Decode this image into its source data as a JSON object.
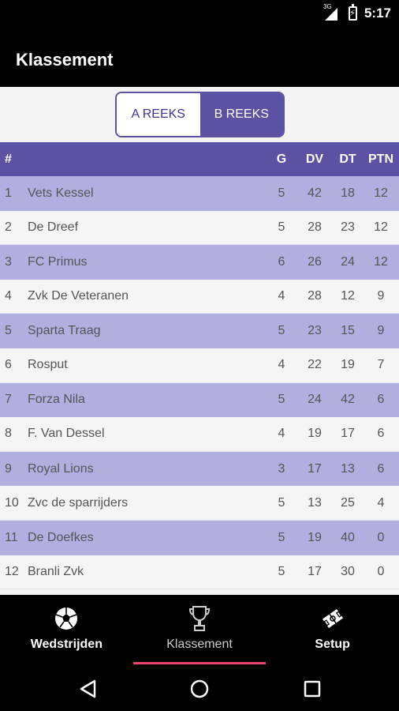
{
  "status_bar": {
    "network": "3G",
    "time": "5:17"
  },
  "app_bar": {
    "title": "Klassement"
  },
  "segment": {
    "options": [
      "A REEKS",
      "B REEKS"
    ],
    "selected": "B REEKS"
  },
  "table": {
    "headers": {
      "rank": "#",
      "team": "",
      "g": "G",
      "dv": "DV",
      "dt": "DT",
      "ptn": "PTN"
    },
    "rows": [
      {
        "rank": "1",
        "team": "Vets Kessel",
        "g": "5",
        "dv": "42",
        "dt": "18",
        "ptn": "12"
      },
      {
        "rank": "2",
        "team": "De Dreef",
        "g": "5",
        "dv": "28",
        "dt": "23",
        "ptn": "12"
      },
      {
        "rank": "3",
        "team": "FC Primus",
        "g": "6",
        "dv": "26",
        "dt": "24",
        "ptn": "12"
      },
      {
        "rank": "4",
        "team": "Zvk De Veteranen",
        "g": "4",
        "dv": "28",
        "dt": "12",
        "ptn": "9"
      },
      {
        "rank": "5",
        "team": "Sparta Traag",
        "g": "5",
        "dv": "23",
        "dt": "15",
        "ptn": "9"
      },
      {
        "rank": "6",
        "team": "Rosput",
        "g": "4",
        "dv": "22",
        "dt": "19",
        "ptn": "7"
      },
      {
        "rank": "7",
        "team": "Forza Nila",
        "g": "5",
        "dv": "24",
        "dt": "42",
        "ptn": "6"
      },
      {
        "rank": "8",
        "team": "F. Van Dessel",
        "g": "4",
        "dv": "19",
        "dt": "17",
        "ptn": "6"
      },
      {
        "rank": "9",
        "team": "Royal Lions",
        "g": "3",
        "dv": "17",
        "dt": "13",
        "ptn": "6"
      },
      {
        "rank": "10",
        "team": "Zvc de sparrijders",
        "g": "5",
        "dv": "13",
        "dt": "25",
        "ptn": "4"
      },
      {
        "rank": "11",
        "team": "De Doefkes",
        "g": "5",
        "dv": "19",
        "dt": "40",
        "ptn": "0"
      },
      {
        "rank": "12",
        "team": "Branli Zvk",
        "g": "5",
        "dv": "17",
        "dt": "30",
        "ptn": "0"
      }
    ]
  },
  "bottom_nav": {
    "items": [
      {
        "label": "Wedstrijden",
        "icon": "soccer-ball-icon"
      },
      {
        "label": "Klassement",
        "icon": "trophy-icon"
      },
      {
        "label": "Setup",
        "icon": "field-icon"
      }
    ],
    "selected": "Klassement"
  },
  "system_nav": {
    "icons": [
      "back-icon",
      "home-icon",
      "recents-icon"
    ]
  },
  "colors": {
    "accent": "#5c52a3",
    "row_highlight": "#b2aee0",
    "indicator": "#e9466e"
  }
}
